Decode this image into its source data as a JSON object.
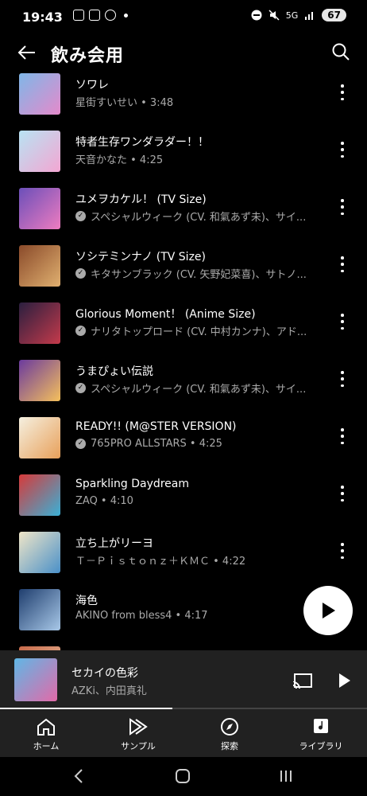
{
  "status": {
    "time": "19:43",
    "battery": "67",
    "net": "5G"
  },
  "header": {
    "title": "飲み会用"
  },
  "tracks": [
    {
      "title": "ソワレ",
      "subtitle": "星街すいせい • 3:48",
      "verified": false,
      "colors": [
        "#7fb7e8",
        "#e48acb"
      ]
    },
    {
      "title": "特者生存ワンダラダー！！",
      "subtitle": "天音かなた • 4:25",
      "verified": false,
      "colors": [
        "#b8e3f3",
        "#f3a6d2"
      ]
    },
    {
      "title": "ユメヲカケル！ (TV Size)",
      "subtitle": "スペシャルウィーク (CV. 和氣あず未)、サイ...",
      "verified": true,
      "colors": [
        "#6b4fb9",
        "#ee7cc0"
      ]
    },
    {
      "title": "ソシテミンナノ (TV Size)",
      "subtitle": "キタサンブラック (CV. 矢野妃菜喜)、サトノ...",
      "verified": true,
      "colors": [
        "#8a4a2a",
        "#e0b070"
      ]
    },
    {
      "title": "Glorious Moment！ (Anime Size)",
      "subtitle": "ナリタトップロード (CV. 中村カンナ)、アド...",
      "verified": true,
      "colors": [
        "#2a1f3f",
        "#c43a4b"
      ]
    },
    {
      "title": "うまぴょい伝説",
      "subtitle": "スペシャルウィーク (CV. 和氣あず未)、サイ...",
      "verified": true,
      "colors": [
        "#6b3a9e",
        "#f5c05c"
      ]
    },
    {
      "title": "READY!! (M@STER VERSION)",
      "subtitle": "765PRO ALLSTARS • 4:25",
      "verified": true,
      "colors": [
        "#f5f0e0",
        "#e8a05a"
      ]
    },
    {
      "title": "Sparkling Daydream",
      "subtitle": "ZAQ • 4:10",
      "verified": false,
      "colors": [
        "#d63a3a",
        "#3ab0d6"
      ]
    },
    {
      "title": "立ち上がリーヨ",
      "subtitle": "Ｔ－Ｐｉｓｔｏｎｚ＋ＫＭＣ • 4:22",
      "verified": false,
      "colors": [
        "#f0e6c8",
        "#4a90c8"
      ]
    },
    {
      "title": "海色",
      "subtitle": "AKINO from bless4 • 4:17",
      "verified": false,
      "colors": [
        "#1f3e6e",
        "#a8c8e8"
      ]
    },
    {
      "title": "",
      "subtitle": "",
      "verified": false,
      "colors": [
        "#c86a4a",
        "#e8c0a0"
      ]
    }
  ],
  "now_playing": {
    "title": "セカイの色彩",
    "artist": "AZKi、内田真礼",
    "progress": 0.47,
    "colors": [
      "#5fb7e6",
      "#e26aa8"
    ]
  },
  "nav": [
    {
      "label": "ホーム",
      "icon": "home-icon"
    },
    {
      "label": "サンプル",
      "icon": "samples-icon"
    },
    {
      "label": "探索",
      "icon": "compass-icon"
    },
    {
      "label": "ライブラリ",
      "icon": "library-icon"
    }
  ]
}
